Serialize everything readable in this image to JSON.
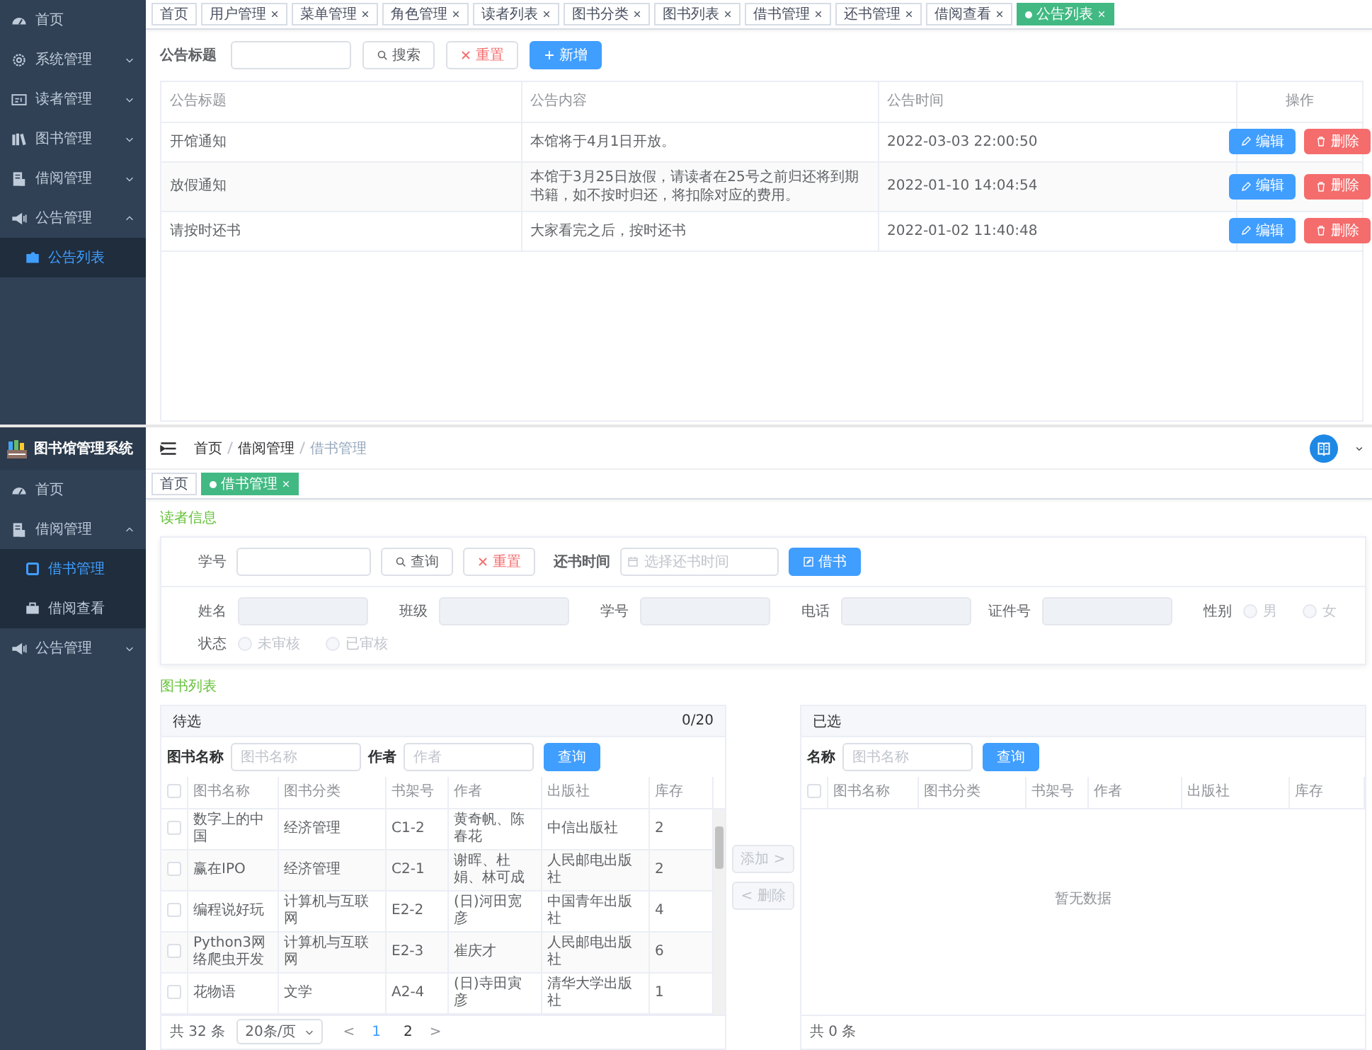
{
  "notice_screen": {
    "sidebar": {
      "items": [
        {
          "label": "首页"
        },
        {
          "label": "系统管理",
          "expanded": false
        },
        {
          "label": "读者管理",
          "expanded": false
        },
        {
          "label": "图书管理",
          "expanded": false
        },
        {
          "label": "借阅管理",
          "expanded": false
        },
        {
          "label": "公告管理",
          "expanded": true,
          "children": [
            {
              "label": "公告列表",
              "selected": true
            }
          ]
        }
      ]
    },
    "tabs": [
      {
        "label": "首页",
        "selected": false,
        "closable": false
      },
      {
        "label": "用户管理",
        "selected": false,
        "closable": true
      },
      {
        "label": "菜单管理",
        "selected": false,
        "closable": true
      },
      {
        "label": "角色管理",
        "selected": false,
        "closable": true
      },
      {
        "label": "读者列表",
        "selected": false,
        "closable": true
      },
      {
        "label": "图书分类",
        "selected": false,
        "closable": true
      },
      {
        "label": "图书列表",
        "selected": false,
        "closable": true
      },
      {
        "label": "借书管理",
        "selected": false,
        "closable": true
      },
      {
        "label": "还书管理",
        "selected": false,
        "closable": true
      },
      {
        "label": "借阅查看",
        "selected": false,
        "closable": true
      },
      {
        "label": "公告列表",
        "selected": true,
        "closable": true
      }
    ],
    "search": {
      "label": "公告标题",
      "buttons": [
        {
          "kind": "search",
          "label": "搜索"
        },
        {
          "kind": "reset",
          "label": "重置"
        },
        {
          "kind": "add",
          "label": "新增"
        }
      ]
    },
    "table": {
      "columns": [
        "公告标题",
        "公告内容",
        "公告时间",
        "操作"
      ],
      "rows": [
        {
          "title": "开馆通知",
          "content": "本馆将于4月1日开放。",
          "time": "2022-03-03 22:00:50",
          "actions": [
            "编辑",
            "删除"
          ]
        },
        {
          "title": "放假通知",
          "content": "本馆于3月25日放假，请读者在25号之前归还将到期书籍，如不按时归还，将扣除对应的费用。",
          "time": "2022-01-10 14:04:54",
          "actions": [
            "编辑",
            "删除"
          ]
        },
        {
          "title": "请按时还书",
          "content": "大家看完之后，按时还书",
          "time": "2022-01-02 11:40:48",
          "actions": [
            "编辑",
            "删除"
          ]
        }
      ]
    }
  },
  "borrow_screen": {
    "app_title": "图书馆管理系统",
    "sidebar": {
      "items": [
        {
          "label": "首页"
        },
        {
          "label": "借阅管理",
          "expanded": true,
          "children": [
            {
              "label": "借书管理",
              "selected": true
            },
            {
              "label": "借阅查看",
              "selected": false
            }
          ]
        },
        {
          "label": "公告管理",
          "expanded": false
        }
      ]
    },
    "breadcrumb": [
      "首页",
      "借阅管理",
      "借书管理"
    ],
    "tabs": [
      {
        "label": "首页",
        "selected": false,
        "closable": false
      },
      {
        "label": "借书管理",
        "selected": true,
        "closable": true
      }
    ],
    "reader_section": {
      "title": "读者信息",
      "query": {
        "label": "学号",
        "buttons": [
          {
            "kind": "search",
            "label": "查询"
          },
          {
            "kind": "reset",
            "label": "重置"
          }
        ],
        "return_label": "还书时间",
        "return_placeholder": "选择还书时间",
        "borrow_button": "借书"
      },
      "fields": [
        {
          "label": "姓名",
          "disabled": true
        },
        {
          "label": "班级",
          "disabled": true
        },
        {
          "label": "学号",
          "disabled": true
        },
        {
          "label": "电话",
          "disabled": true
        },
        {
          "label": "证件号",
          "disabled": true
        }
      ],
      "gender": {
        "label": "性别",
        "disabled": true,
        "options": [
          {
            "label": "男",
            "selected": false
          },
          {
            "label": "女",
            "selected": false
          }
        ]
      },
      "status": {
        "label": "状态",
        "disabled": true,
        "options": [
          {
            "label": "未审核",
            "selected": false
          },
          {
            "label": "已审核",
            "selected": false
          }
        ]
      }
    },
    "book_section": {
      "title": "图书列表",
      "transfer_buttons": [
        {
          "label": "添加 >",
          "disabled": true
        },
        {
          "label": "< 删除",
          "disabled": true
        }
      ],
      "left": {
        "title": "待选",
        "count": "0/20",
        "filters": [
          {
            "label": "图书名称",
            "placeholder": "图书名称"
          },
          {
            "label": "作者",
            "placeholder": "作者"
          }
        ],
        "query_button": "查询",
        "columns": [
          "图书名称",
          "图书分类",
          "书架号",
          "作者",
          "出版社",
          "库存"
        ],
        "header_checked": false,
        "rows": [
          {
            "checked": false,
            "cells": [
              "数字上的中国",
              "经济管理",
              "C1-2",
              "黄奇帆、陈春花",
              "中信出版社",
              "2"
            ]
          },
          {
            "checked": false,
            "cells": [
              "赢在IPO",
              "经济管理",
              "C2-1",
              "谢晖、杜娟、林可成",
              "人民邮电出版社",
              "2"
            ]
          },
          {
            "checked": false,
            "cells": [
              "编程说好玩",
              "计算机与互联网",
              "E2-2",
              "(日)河田宽彦",
              "中国青年出版社",
              "4"
            ]
          },
          {
            "checked": false,
            "cells": [
              "Python3网络爬虫开发",
              "计算机与互联网",
              "E2-3",
              "崔庆才",
              "人民邮电出版社",
              "6"
            ]
          },
          {
            "checked": false,
            "cells": [
              "花物语",
              "文学",
              "A2-4",
              "(日)寺田寅彦",
              "清华大学出版社",
              "1"
            ]
          }
        ],
        "total": "共 32 条",
        "page_size": "20条/页",
        "prev": "<",
        "pages": [
          {
            "label": "1",
            "selected": true
          },
          {
            "label": "2",
            "selected": false
          }
        ],
        "next": ">"
      },
      "right": {
        "title": "已选",
        "filters": [
          {
            "label": "名称",
            "placeholder": "图书名称"
          }
        ],
        "query_button": "查询",
        "columns": [
          "图书名称",
          "图书分类",
          "书架号",
          "作者",
          "出版社",
          "库存"
        ],
        "header_checked": false,
        "empty_text": "暂无数据",
        "total": "共 0 条"
      }
    }
  }
}
